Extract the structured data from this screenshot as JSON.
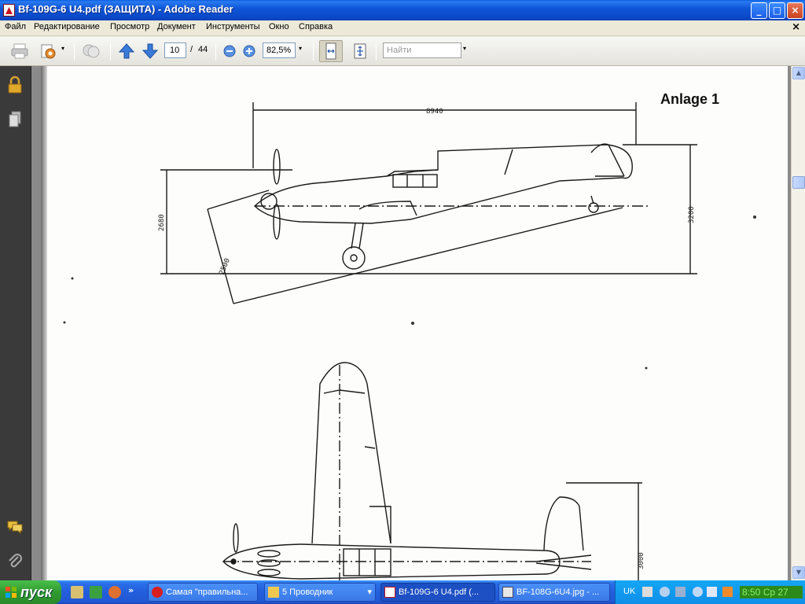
{
  "window": {
    "title": "Bf-109G-6 U4.pdf (ЗАЩИТА) - Adobe Reader",
    "buttons": {
      "minimize": "_",
      "maximize": "□",
      "close": "×"
    }
  },
  "menu": {
    "items": [
      "Файл",
      "Редактирование",
      "Просмотр",
      "Документ",
      "Инструменты",
      "Окно",
      "Справка"
    ],
    "doc_close": "×"
  },
  "toolbar": {
    "current_page": "10",
    "page_separator": "/",
    "total_pages": "44",
    "zoom": "82,5%",
    "find_placeholder": "Найти",
    "dropdown_arrow": "▾"
  },
  "document": {
    "heading": "Anlage 1",
    "dimensions": {
      "length": "8940",
      "height_left": "2680",
      "prop_clearance": "2500",
      "height_right": "3200",
      "tail_height": "3000"
    }
  },
  "scrollbar": {
    "up": "▲",
    "down": "▼"
  },
  "taskbar": {
    "start_label": "пуск",
    "more_quicklaunch": "»",
    "tasks": [
      {
        "label": "Самая \"правильна...",
        "active": false
      },
      {
        "label": "5 Проводник",
        "active": false
      },
      {
        "label": "Bf-109G-6 U4.pdf (...",
        "active": true
      },
      {
        "label": "BF-108G-6U4.jpg - ...",
        "active": false
      }
    ],
    "explorer_dropdown": "▾",
    "tray": {
      "language": "UK",
      "clock": "8:50 Ср 27"
    }
  },
  "colors": {
    "titlebar": "#0a47c6",
    "taskbar": "#245edc",
    "start_button": "#2f9a2f",
    "tray": "#0f8ee8",
    "nav_panel": "#3a3a3a",
    "page": "#fdfdfb"
  }
}
